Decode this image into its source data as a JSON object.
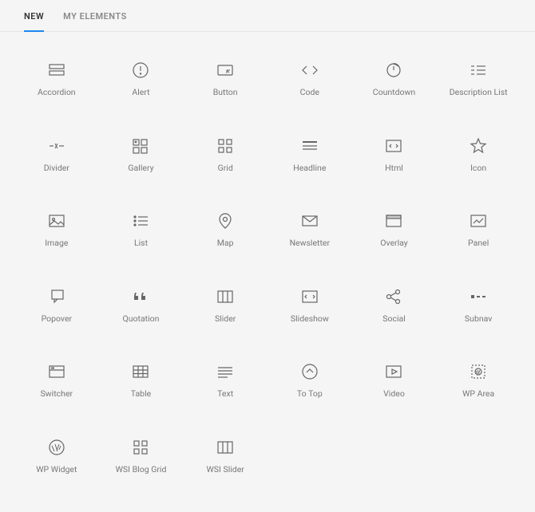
{
  "tabs": {
    "new": "NEW",
    "my": "MY ELEMENTS",
    "active": "new"
  },
  "elements": [
    {
      "id": "accordion",
      "label": "Accordion"
    },
    {
      "id": "alert",
      "label": "Alert"
    },
    {
      "id": "button",
      "label": "Button"
    },
    {
      "id": "code",
      "label": "Code"
    },
    {
      "id": "countdown",
      "label": "Countdown"
    },
    {
      "id": "description-list",
      "label": "Description List"
    },
    {
      "id": "divider",
      "label": "Divider"
    },
    {
      "id": "gallery",
      "label": "Gallery"
    },
    {
      "id": "grid",
      "label": "Grid"
    },
    {
      "id": "headline",
      "label": "Headline"
    },
    {
      "id": "html",
      "label": "Html"
    },
    {
      "id": "icon",
      "label": "Icon"
    },
    {
      "id": "image",
      "label": "Image"
    },
    {
      "id": "list",
      "label": "List"
    },
    {
      "id": "map",
      "label": "Map"
    },
    {
      "id": "newsletter",
      "label": "Newsletter"
    },
    {
      "id": "overlay",
      "label": "Overlay"
    },
    {
      "id": "panel",
      "label": "Panel"
    },
    {
      "id": "popover",
      "label": "Popover"
    },
    {
      "id": "quotation",
      "label": "Quotation"
    },
    {
      "id": "slider",
      "label": "Slider"
    },
    {
      "id": "slideshow",
      "label": "Slideshow"
    },
    {
      "id": "social",
      "label": "Social"
    },
    {
      "id": "subnav",
      "label": "Subnav"
    },
    {
      "id": "switcher",
      "label": "Switcher"
    },
    {
      "id": "table",
      "label": "Table"
    },
    {
      "id": "text",
      "label": "Text"
    },
    {
      "id": "to-top",
      "label": "To Top"
    },
    {
      "id": "video",
      "label": "Video"
    },
    {
      "id": "wp-area",
      "label": "WP Area"
    },
    {
      "id": "wp-widget",
      "label": "WP Widget"
    },
    {
      "id": "wsi-blog-grid",
      "label": "WSI Blog Grid"
    },
    {
      "id": "wsi-slider",
      "label": "WSI Slider"
    }
  ]
}
